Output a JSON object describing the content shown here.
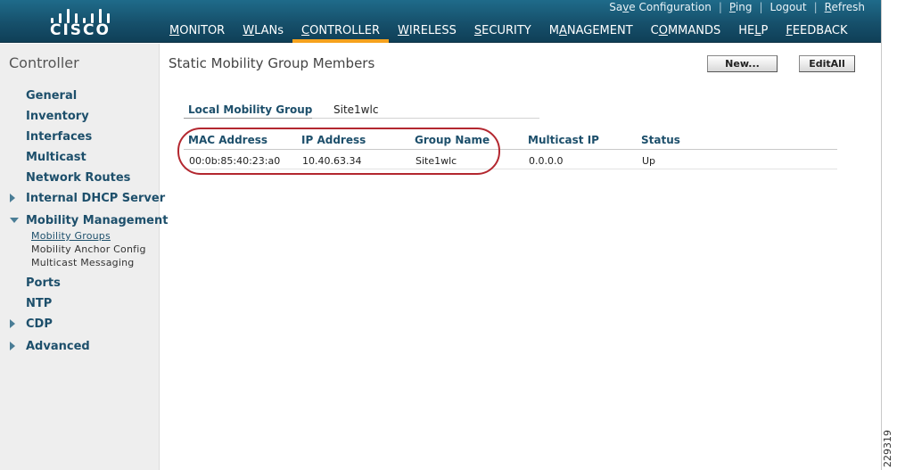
{
  "header": {
    "logo_text": "CISCO",
    "top_links": [
      {
        "id": "save",
        "label": "Save Configuration"
      },
      {
        "id": "ping",
        "label": "Ping"
      },
      {
        "id": "logout",
        "label": "Logout"
      },
      {
        "id": "refresh",
        "label": "Refresh"
      }
    ],
    "nav": [
      {
        "label": "MONITOR",
        "key": "M",
        "rest": "ONITOR"
      },
      {
        "label": "WLANs",
        "key": "W",
        "rest": "LANs"
      },
      {
        "label": "CONTROLLER",
        "key": "C",
        "rest": "ONTROLLER"
      },
      {
        "label": "WIRELESS",
        "key": "W",
        "rest": "IRELESS"
      },
      {
        "label": "SECURITY",
        "key": "S",
        "rest": "ECURITY"
      },
      {
        "label": "MANAGEMENT",
        "pre": "M",
        "key": "A",
        "rest": "NAGEMENT"
      },
      {
        "label": "COMMANDS",
        "pre": "C",
        "key": "O",
        "rest": "MMANDS"
      },
      {
        "label": "HELP",
        "pre": "HE",
        "key": "L",
        "rest": "P"
      },
      {
        "label": "FEEDBACK",
        "key": "F",
        "rest": "EEDBACK"
      }
    ],
    "accent_color": "#f6a21e"
  },
  "sidebar": {
    "title": "Controller",
    "items": {
      "general": "General",
      "inventory": "Inventory",
      "interfaces": "Interfaces",
      "multicast": "Multicast",
      "network_routes": "Network Routes",
      "internal_dhcp": "Internal DHCP Server",
      "mobility_mgmt": "Mobility Management",
      "ports": "Ports",
      "ntp": "NTP",
      "cdp": "CDP",
      "advanced": "Advanced"
    },
    "sub_items": {
      "mobility_groups": "Mobility Groups",
      "mobility_anchor": "Mobility Anchor Config",
      "multicast_messaging": "Multicast Messaging"
    }
  },
  "main": {
    "title": "Static Mobility Group Members",
    "buttons": {
      "new": "New...",
      "edit_all": "EditAll"
    },
    "local_group": {
      "label": "Local Mobility Group",
      "value": "Site1wlc"
    },
    "table": {
      "headers": {
        "mac": "MAC Address",
        "ip": "IP Address",
        "group": "Group Name",
        "mcast": "Multicast IP",
        "status": "Status"
      },
      "rows": [
        {
          "mac": "00:0b:85:40:23:a0",
          "ip": "10.40.63.34",
          "group": "Site1wlc",
          "mcast": "0.0.0.0",
          "status": "Up"
        }
      ]
    },
    "highlight_color": "#b3272f"
  },
  "figure_id": "229319"
}
